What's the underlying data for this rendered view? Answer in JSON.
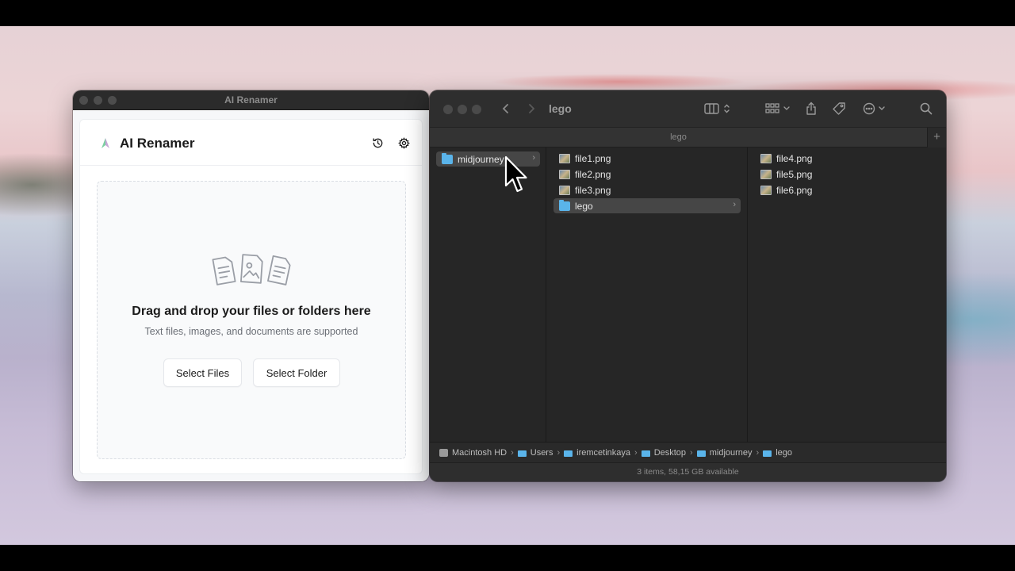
{
  "ai_renamer": {
    "window_title": "AI Renamer",
    "app_name": "AI Renamer",
    "header_icons": [
      "history-icon",
      "gear-icon"
    ],
    "dropzone": {
      "icons": [
        "document-icon",
        "image-file-icon",
        "document-icon"
      ],
      "title": "Drag and drop your files or folders here",
      "subtitle": "Text files, images, and documents are supported"
    },
    "buttons": {
      "select_files": "Select Files",
      "select_folder": "Select Folder"
    }
  },
  "finder": {
    "title": "lego",
    "tab_label": "lego",
    "tab_add": "+",
    "columns": [
      {
        "items": [
          {
            "name": "midjourney",
            "kind": "folder",
            "selected": true
          }
        ]
      },
      {
        "items": [
          {
            "name": "file1.png",
            "kind": "png"
          },
          {
            "name": "file2.png",
            "kind": "png"
          },
          {
            "name": "file3.png",
            "kind": "png"
          },
          {
            "name": "lego",
            "kind": "folder",
            "selected": true
          }
        ]
      },
      {
        "items": [
          {
            "name": "file4.png",
            "kind": "png"
          },
          {
            "name": "file5.png",
            "kind": "png"
          },
          {
            "name": "file6.png",
            "kind": "png"
          }
        ]
      }
    ],
    "path": [
      "Macintosh HD",
      "Users",
      "iremcetinkaya",
      "Desktop",
      "midjourney",
      "lego"
    ],
    "path_separator": "›",
    "chevron": "›",
    "status": "3 items, 58,15 GB available"
  },
  "colors": {
    "folder_blue": "#5ab4ea",
    "finder_bg": "#262626",
    "selection": "#464646"
  }
}
